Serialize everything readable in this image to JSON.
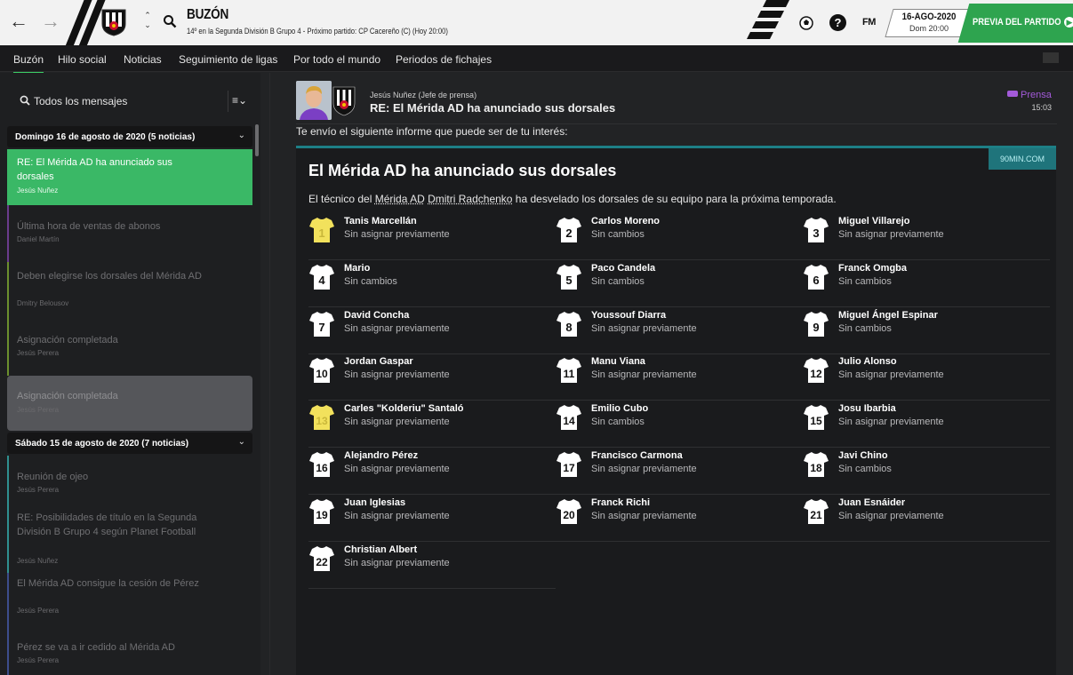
{
  "topbar": {
    "title": "BUZÓN",
    "subtitle": "14º en la Segunda División B Grupo 4 - Próximo partido: CP Cacereño (C) (Hoy 20:00)",
    "fm_label": "FM",
    "date": "16-AGO-2020",
    "day_time": "Dom 20:00",
    "preview_button": "PREVIA DEL PARTIDO"
  },
  "subnav": {
    "tabs": [
      "Buzón",
      "Hilo social",
      "Noticias",
      "Seguimiento de ligas",
      "Por todo el mundo",
      "Periodos de fichajes"
    ]
  },
  "inbox": {
    "filter_label": "Todos los mensajes",
    "sort_icon": "≡⌄",
    "day1": "Domingo 16 de agosto de 2020 (5 noticias)",
    "day2": "Sábado 15 de agosto de 2020 (7 noticias)",
    "messages": [
      {
        "title": "RE: El Mérida AD ha anunciado sus dorsales",
        "from": "Jesús Nuñez"
      },
      {
        "title": "Última hora de ventas de abonos",
        "from": "Daniel Martín"
      },
      {
        "title": "Deben elegirse los dorsales del Mérida AD",
        "from": "Dmitry Belousov"
      },
      {
        "title": "Asignación completada",
        "from": "Jesús Perera"
      },
      {
        "title": "Asignación completada",
        "from": "Jesús Perera"
      },
      {
        "title": "Reunión de ojeo",
        "from": "Jesús Perera"
      },
      {
        "title": "RE: Posibilidades de título en la Segunda División B Grupo 4 según Planet Football",
        "from": "Jesús Nuñez"
      },
      {
        "title": "El Mérida AD consigue la cesión de Pérez",
        "from": "Jesús Perera"
      },
      {
        "title": "Pérez se va a ir cedido al Mérida AD",
        "from": "Jesús Perera"
      }
    ]
  },
  "message": {
    "sender": "Jesús Nuñez  (Jefe de prensa)",
    "subject": "RE: El Mérida AD ha anunciado sus dorsales",
    "tag": "Prensa",
    "time": "15:03",
    "intro": "Te envío el siguiente informe que puede ser de tu interés:"
  },
  "article": {
    "source": "90MIN.COM",
    "title": "El Mérida AD ha anunciado sus dorsales",
    "lead_a": "El técnico del ",
    "lead_club": "Mérida AD",
    "lead_space": " ",
    "lead_coach": "Dmitri Radchenko",
    "lead_b": " ha desvelado los dorsales de su equipo para la próxima temporada.",
    "numbers": [
      {
        "number": "1",
        "name": "Tanis Marcellán",
        "status": "Sin asignar previamente",
        "keeper": true
      },
      {
        "number": "2",
        "name": "Carlos Moreno",
        "status": "Sin cambios"
      },
      {
        "number": "3",
        "name": "Miguel Villarejo",
        "status": "Sin asignar previamente"
      },
      {
        "number": "4",
        "name": "Mario",
        "status": "Sin cambios"
      },
      {
        "number": "5",
        "name": "Paco Candela",
        "status": "Sin cambios"
      },
      {
        "number": "6",
        "name": "Franck Omgba",
        "status": "Sin cambios"
      },
      {
        "number": "7",
        "name": "David Concha",
        "status": "Sin asignar previamente"
      },
      {
        "number": "8",
        "name": "Youssouf Diarra",
        "status": "Sin asignar previamente"
      },
      {
        "number": "9",
        "name": "Miguel Ángel Espinar",
        "status": "Sin cambios"
      },
      {
        "number": "10",
        "name": "Jordan Gaspar",
        "status": "Sin asignar previamente"
      },
      {
        "number": "11",
        "name": "Manu Viana",
        "status": "Sin asignar previamente"
      },
      {
        "number": "12",
        "name": "Julio Alonso",
        "status": "Sin asignar previamente"
      },
      {
        "number": "13",
        "name": "Carles \"Kolderiu\" Santaló",
        "status": "Sin asignar previamente",
        "keeper": true
      },
      {
        "number": "14",
        "name": "Emilio Cubo",
        "status": "Sin cambios"
      },
      {
        "number": "15",
        "name": "Josu Ibarbia",
        "status": "Sin asignar previamente"
      },
      {
        "number": "16",
        "name": "Alejandro Pérez",
        "status": "Sin asignar previamente"
      },
      {
        "number": "17",
        "name": "Francisco Carmona",
        "status": "Sin asignar previamente"
      },
      {
        "number": "18",
        "name": "Javi Chino",
        "status": "Sin cambios"
      },
      {
        "number": "19",
        "name": "Juan Iglesias",
        "status": "Sin asignar previamente"
      },
      {
        "number": "20",
        "name": "Franck Richi",
        "status": "Sin asignar previamente"
      },
      {
        "number": "21",
        "name": "Juan Esnáider",
        "status": "Sin asignar previamente"
      },
      {
        "number": "22",
        "name": "Christian Albert",
        "status": "Sin asignar previamente"
      }
    ]
  },
  "colors": {
    "accent_green": "#3ab866",
    "teal": "#1d7f86",
    "press_purple": "#a35ad9",
    "keeper_yellow": "#f2e15c"
  }
}
